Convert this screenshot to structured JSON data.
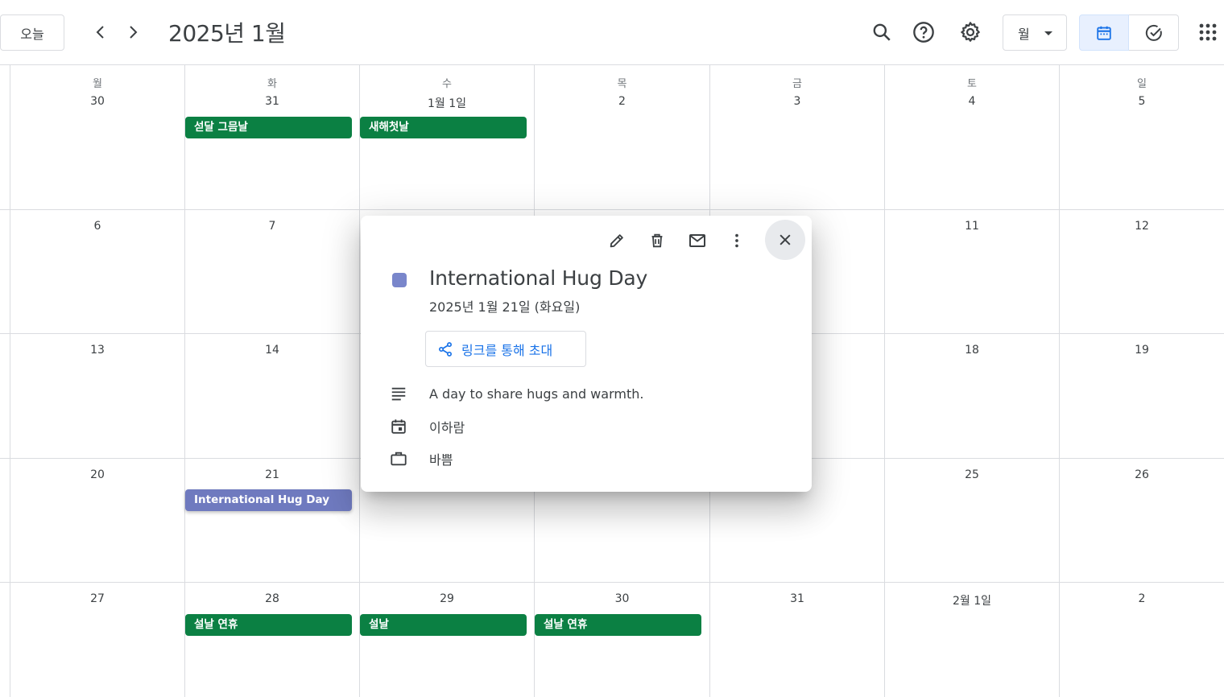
{
  "header": {
    "today_label": "오늘",
    "title": "2025년 1월",
    "view_label": "월"
  },
  "weekdays": [
    "월",
    "화",
    "수",
    "목",
    "금",
    "토",
    "일"
  ],
  "weeks": [
    {
      "days": [
        "30",
        "31",
        "1월 1일",
        "2",
        "3",
        "4",
        "5"
      ]
    },
    {
      "days": [
        "6",
        "7",
        "",
        "",
        "",
        "11",
        "12"
      ]
    },
    {
      "days": [
        "13",
        "14",
        "",
        "",
        "",
        "18",
        "19"
      ]
    },
    {
      "days": [
        "20",
        "21",
        "",
        "",
        "",
        "25",
        "26"
      ]
    },
    {
      "days": [
        "27",
        "28",
        "29",
        "30",
        "31",
        "2월 1일",
        "2"
      ]
    }
  ],
  "events": {
    "e1": "섣달 그믐날",
    "e2": "새해첫날",
    "e3": "International Hug Day",
    "e4": "설날 연휴",
    "e5": "설날",
    "e6": "설날 연휴"
  },
  "popup": {
    "title": "International Hug Day",
    "date": "2025년 1월 21일 (화요일)",
    "invite_label": "링크를 통해 초대",
    "description": "A day to share hugs and warmth.",
    "calendar": "이하람",
    "status": "바쁨",
    "color": "#7986cb"
  },
  "colors": {
    "holiday": "#0b8043",
    "event": "#7986cb",
    "accent": "#1a73e8"
  }
}
